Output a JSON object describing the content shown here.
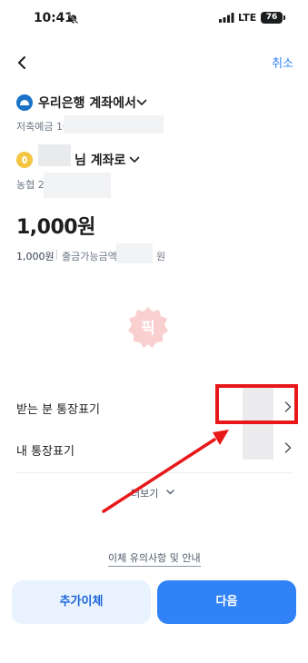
{
  "status_bar": {
    "time": "10:41",
    "network": "LTE",
    "battery": "76"
  },
  "header": {
    "cancel_label": "취소"
  },
  "from": {
    "title": "우리은행 계좌에서",
    "account_prefix": "저축예금 10"
  },
  "to": {
    "title": "님 계좌로",
    "account_prefix": "농협 2"
  },
  "amount": {
    "main": "1,000원",
    "small": "1,000원",
    "available_label": "출금가능금액",
    "available_unit": "원"
  },
  "watermark": {
    "text": "픽"
  },
  "options": {
    "recipient_label": "받는 분 통장표기",
    "mine_label": "내 통장표기",
    "more_label": "더보기"
  },
  "footer": {
    "notice_link": "이체 유의사항 및 안내",
    "add_transfer_label": "추가이체",
    "next_label": "다음"
  },
  "colors": {
    "accent": "#3182f6",
    "annotation_red": "#e8181a"
  }
}
